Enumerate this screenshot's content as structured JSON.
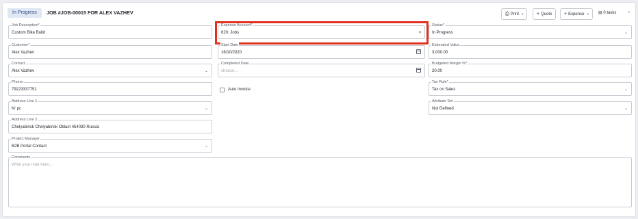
{
  "header": {
    "status_badge": "In Progress",
    "title": "JOB #JOB-00015 FOR ALEX VAZHEV",
    "print_label": "Print",
    "quote_label": "Quote",
    "expense_label": "Expense",
    "tasks_label": "0 tasks"
  },
  "fields": {
    "job_description": {
      "label": "Job Description*",
      "value": "Custom Bike Build"
    },
    "expense_account": {
      "label": "Expense Account*",
      "value": "620: Jobs"
    },
    "status": {
      "label": "Status*",
      "value": "In Progress"
    },
    "customer": {
      "label": "Customer*",
      "value": "Alex Vazhev"
    },
    "start_date": {
      "label": "Start Date",
      "value": "16/10/2020"
    },
    "estimated_value": {
      "label": "Estimated Value",
      "value": "3,000.00"
    },
    "contact": {
      "label": "Contact",
      "value": "Alex Vazhev"
    },
    "completed_date": {
      "label": "Completed Date",
      "placeholder": "choose..."
    },
    "budgeted_margin": {
      "label": "Budgeted Margin %*",
      "value": "20.00"
    },
    "phone": {
      "label": "Phone",
      "value": "79223337751"
    },
    "auto_invoice": {
      "label": "Auto Invoice"
    },
    "tax_rule": {
      "label": "Tax Rule*",
      "value": "Tax on Sales"
    },
    "address_line_1": {
      "label": "Address Line 1",
      "value": "Kr pc"
    },
    "attribute_set": {
      "label": "Attribute Set",
      "value": "Not Defined"
    },
    "address_line_2": {
      "label": "Address Line 2",
      "value": "Chelyabinsk Chelyabinsk Oblast 454030 Russia"
    },
    "project_manager": {
      "label": "Project Manager",
      "value": "B2B Portal Contact"
    },
    "comments": {
      "label": "Comments",
      "placeholder": "Write your note here..."
    }
  },
  "colors": {
    "highlight": "#e0301e",
    "badge_bg": "#dfe8f4",
    "border": "#c9cdd3"
  },
  "icons": {
    "print": "printer-icon",
    "quote": "plus-icon",
    "expense": "plus-icon",
    "tasks": "clipboard-icon",
    "collapse": "chevron-up-icon",
    "dropdown": "chevron-down-icon",
    "date": "calendar-icon"
  }
}
